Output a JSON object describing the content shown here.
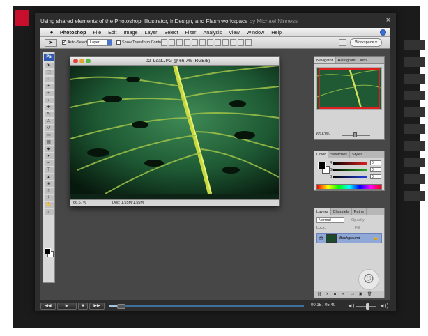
{
  "modal": {
    "title": "Using shared elements of the Photoshop, Illustrator, InDesign, and Flash workspace",
    "author": "by Michael Ninness",
    "close_glyph": "×"
  },
  "menubar": {
    "items": [
      "Photoshop",
      "File",
      "Edit",
      "Image",
      "Layer",
      "Select",
      "Filter",
      "Analysis",
      "View",
      "Window",
      "Help"
    ]
  },
  "options": {
    "auto_select_label": "Auto-Select:",
    "auto_select_value": "Layer",
    "show_transform_label": "Show Transform Controls",
    "workspace_label": "Workspace ▾"
  },
  "toolbox": {
    "logo": "Ps"
  },
  "document": {
    "title": "02_Leaf.JPG @ 66.7% (RGB/8)",
    "zoom": "66.67%",
    "doc_size": "Doc: 1.55M/1.55M"
  },
  "navigator": {
    "tabs": [
      "Navigator",
      "Histogram",
      "Info"
    ],
    "zoom": "66.67%"
  },
  "color_panel": {
    "tabs": [
      "Color",
      "Swatches",
      "Styles"
    ],
    "channels": [
      {
        "label": "R",
        "value": "0",
        "color": "#e02020"
      },
      {
        "label": "G",
        "value": "0",
        "color": "#20b020"
      },
      {
        "label": "B",
        "value": "0",
        "color": "#2040e0"
      }
    ]
  },
  "layers_panel": {
    "tabs": [
      "Layers",
      "Channels",
      "Paths"
    ],
    "blend_mode": "Normal",
    "opacity_label": "Opacity:",
    "lock_label": "Lock:",
    "fill_label": "Fill:",
    "layer_name": "Background"
  },
  "player": {
    "timecode": "00:15 / 05:40",
    "progress_fraction": 0.044,
    "volume_fraction": 0.55
  },
  "colors": {
    "modal_bg": "#2d2d2d",
    "workspace_bg": "#474747",
    "accent_blue": "#3f6f9a"
  }
}
